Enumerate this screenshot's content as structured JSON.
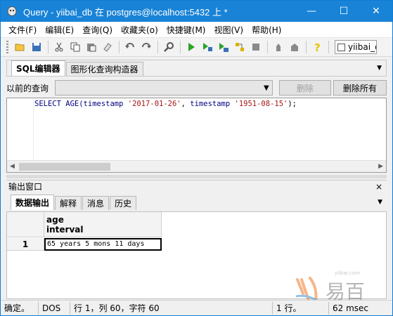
{
  "window": {
    "title": "Query - yiibai_db 在  postgres@localhost:5432 上 *"
  },
  "title_controls": {
    "minimize": "—",
    "maximize": "☐",
    "close": "✕"
  },
  "menu": [
    "文件(F)",
    "编辑(E)",
    "查询(Q)",
    "收藏夹(o)",
    "快捷键(M)",
    "视图(V)",
    "帮助(H)"
  ],
  "toolbar": {
    "db_combo_value": "yiibai_db",
    "icons": [
      "open-icon",
      "save-icon",
      "cut-icon",
      "copy-icon",
      "paste-icon",
      "clear-icon",
      "undo-icon",
      "redo-icon",
      "find-icon",
      "execute-icon",
      "execute-pgscript-icon",
      "execute-to-file-icon",
      "explain-icon",
      "stop-icon",
      "vacuum-icon",
      "commit-icon",
      "help-icon"
    ]
  },
  "editor_tabs": [
    "SQL编辑器",
    "图形化查询构造器"
  ],
  "history": {
    "label": "以前的查询",
    "delete_label": "删除",
    "delete_all_label": "删除所有"
  },
  "sql": {
    "kw1": "SELECT AGE(",
    "arg1_type": "timestamp ",
    "str1": "'2017-01-26'",
    "mid": ", ",
    "arg2_type": "timestamp ",
    "str2": "'1951-08-15'",
    "end": ");"
  },
  "output": {
    "title": "输出窗口",
    "close": "×",
    "tabs": [
      "数据输出",
      "解释",
      "消息",
      "历史"
    ],
    "column": {
      "name": "age",
      "type": "interval"
    },
    "rows": [
      {
        "num": "1",
        "value": "65 years 5 mons 11 days"
      }
    ]
  },
  "status": {
    "state": "确定。",
    "encoding": "DOS",
    "position": "行 1，列 60，字符 60",
    "rows": "1 行。",
    "time": "62 msec"
  },
  "watermark": {
    "text": "易百",
    "url": "yiibai.com"
  },
  "colors": {
    "titlebar": "#1883d7",
    "accent": "#0f7cd6"
  }
}
